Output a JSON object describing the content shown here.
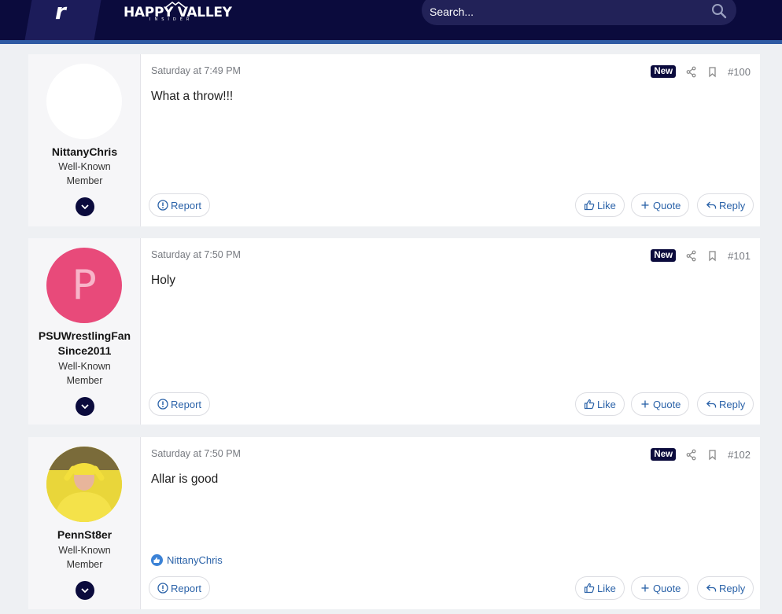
{
  "header": {
    "brand_letter": "r",
    "site_name": "HAPPY VALLEY",
    "site_sub": "INSIDER",
    "search_placeholder": "Search..."
  },
  "posts": [
    {
      "username": "NittanyChris",
      "user_title_1": "Well-Known",
      "user_title_2": "Member",
      "avatar": "blank",
      "date": "Saturday at 7:49 PM",
      "badge": "New",
      "number": "#100",
      "body": "What a throw!!!",
      "report_label": "Report",
      "like_label": "Like",
      "quote_label": "Quote",
      "reply_label": "Reply"
    },
    {
      "username_1": "PSUWrestlingFan",
      "username_2": "Since2011",
      "user_title_1": "Well-Known",
      "user_title_2": "Member",
      "avatar": "letter",
      "avatar_letter": "P",
      "date": "Saturday at 7:50 PM",
      "badge": "New",
      "number": "#101",
      "body": "Holy",
      "report_label": "Report",
      "like_label": "Like",
      "quote_label": "Quote",
      "reply_label": "Reply"
    },
    {
      "username": "PennSt8er",
      "user_title_1": "Well-Known",
      "user_title_2": "Member",
      "avatar": "photo",
      "date": "Saturday at 7:50 PM",
      "badge": "New",
      "number": "#102",
      "body": "Allar is good",
      "reaction_user": "NittanyChris",
      "report_label": "Report",
      "like_label": "Like",
      "quote_label": "Quote",
      "reply_label": "Reply"
    }
  ],
  "colors": {
    "header_bg": "#0b0b3d",
    "accent_stripe": "#2f5aa3",
    "link_blue": "#2a62a8",
    "avatar_pink": "#e84a7a"
  }
}
